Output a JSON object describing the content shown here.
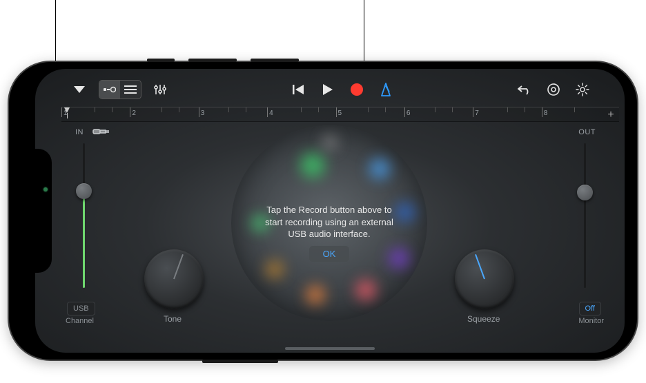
{
  "toolbar": {
    "record_color": "#ff3b30",
    "accent_blue": "#2e9bff"
  },
  "ruler": {
    "marks": [
      1,
      2,
      3,
      4,
      5,
      6,
      7,
      8
    ],
    "plus": "+"
  },
  "input": {
    "label": "IN",
    "channel_btn": "USB",
    "channel_caption": "Channel"
  },
  "output": {
    "label": "OUT",
    "monitor_btn": "Off",
    "monitor_caption": "Monitor"
  },
  "knobs": {
    "tone": "Tone",
    "squeeze": "Squeeze"
  },
  "dialog": {
    "text": "Tap the Record button above to start recording using an external USB audio interface.",
    "ok": "OK"
  }
}
